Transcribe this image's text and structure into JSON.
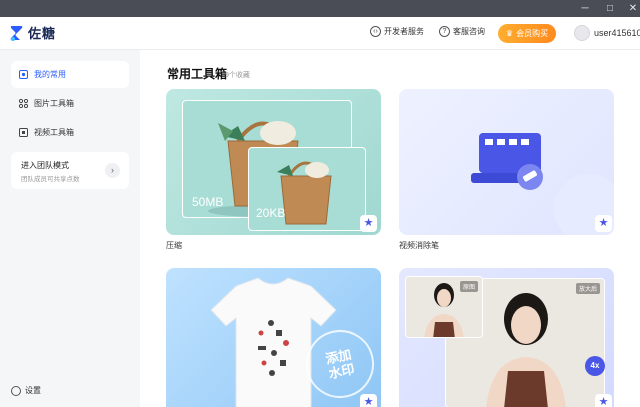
{
  "window": {
    "minimize": "─",
    "maximize": "□",
    "close": "✕"
  },
  "header": {
    "logo_text": "佐糖",
    "dev_service": "开发者服务",
    "support": "客服咨询",
    "vip_button": "会员购买",
    "username": "user415610"
  },
  "sidebar": {
    "items": [
      {
        "label": "我的常用",
        "icon": "star-frame-icon"
      },
      {
        "label": "图片工具箱",
        "icon": "grid-icon"
      },
      {
        "label": "视频工具箱",
        "icon": "film-icon"
      }
    ],
    "team_title": "进入团队模式",
    "team_subtitle": "团队成员可共享点数",
    "team_arrow": "›",
    "settings": "设置"
  },
  "main": {
    "title": "常用工具箱",
    "count": "9个收藏",
    "cards": [
      {
        "label": "压缩",
        "size_before": "50MB",
        "size_after": "20KB"
      },
      {
        "label": "视频消除笔"
      },
      {
        "label": "",
        "stamp_line1": "添加",
        "stamp_line2": "水印"
      },
      {
        "label": "",
        "tag_original": "原图",
        "tag_enlarged": "放大后",
        "scale_badge": "4x"
      }
    ],
    "star_glyph": "★"
  },
  "colors": {
    "accent": "#2b5cff",
    "vip": "#ff9a26",
    "star": "#4a57e6"
  }
}
